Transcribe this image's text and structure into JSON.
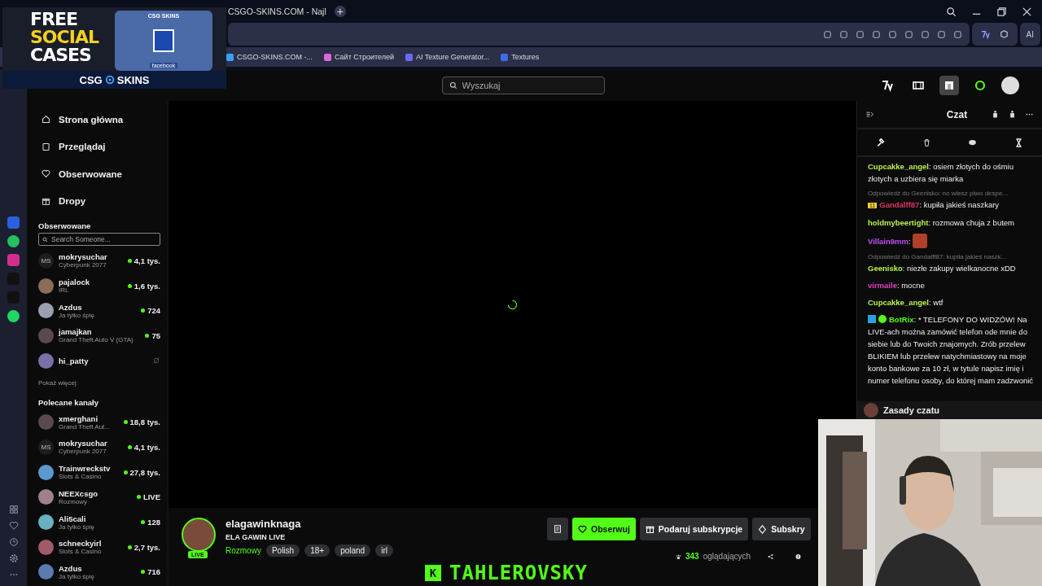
{
  "ad_overlay": {
    "headline": [
      "FREE",
      "SOCIAL",
      "CASES"
    ],
    "brand": "CSG",
    "brand2": "SKINS",
    "box_label": "CSG SKINS",
    "box_tag": "facebook"
  },
  "browser": {
    "tab_title": "CSGO-SKINS.COM - Najl",
    "new_tab": "+",
    "ai_button": "AI",
    "bookmarks": [
      {
        "label": "CSGO-SKINS.COM -...",
        "color": "#3aa0ff"
      },
      {
        "label": "Сайт Строителей",
        "color": "#d86ad8"
      },
      {
        "label": "AI Texture Generator...",
        "color": "#6a6aff"
      },
      {
        "label": "Textures",
        "color": "#3b6cf0"
      }
    ]
  },
  "header": {
    "search": {
      "placeholder": "Wyszukaj"
    }
  },
  "nav": [
    {
      "label": "Strona główna"
    },
    {
      "label": "Przeglądaj"
    },
    {
      "label": "Obserwowane"
    },
    {
      "label": "Dropy"
    }
  ],
  "followed": {
    "title": "Obserwowane",
    "search": {
      "placeholder": "Search Someone..."
    },
    "channels": [
      {
        "name": "mokrysuchar",
        "category": "Cyberpunk 2077",
        "viewers": "4,1 tys.",
        "live": true,
        "initials": "MS"
      },
      {
        "name": "pajalock",
        "category": "IRL",
        "viewers": "1,6 tys.",
        "live": true
      },
      {
        "name": "Azdus",
        "category": "Ja tylko śpię",
        "viewers": "724",
        "live": true
      },
      {
        "name": "jamajkan",
        "category": "Grand Theft Auto V (GTA)",
        "viewers": "75",
        "live": true
      },
      {
        "name": "hi_patty",
        "live": false
      }
    ],
    "show_more": "Pokaż więcej"
  },
  "recommended": {
    "title": "Polecane kanały",
    "channels": [
      {
        "name": "xmerghani",
        "category": "Grand Theft Aut...",
        "viewers": "18,8 tys.",
        "live": true
      },
      {
        "name": "mokrysuchar",
        "category": "Cyberpunk 2077",
        "viewers": "4,1 tys.",
        "live": true,
        "initials": "MS"
      },
      {
        "name": "Trainwreckstv",
        "category": "Slots & Casino",
        "viewers": "27,8 tys.",
        "live": true
      },
      {
        "name": "NEEXcsgo",
        "category": "Rozmowy",
        "viewers": "LIVE",
        "live": true
      },
      {
        "name": "Ali5cali",
        "category": "Ja tylko śpię",
        "viewers": "128",
        "live": true
      },
      {
        "name": "schneckyirl",
        "category": "Slots & Casino",
        "viewers": "2,7 tys.",
        "live": true
      },
      {
        "name": "Azdus",
        "category": "Ja tylko śpię",
        "viewers": "716",
        "live": true
      }
    ]
  },
  "chat": {
    "title": "Czat",
    "separator": ":",
    "messages": [
      {
        "user": "Cupcakke_angel",
        "color": "#b8f04a",
        "text": "osiem złotych do ośmiu złotych a uzbiera się miarka"
      },
      {
        "reply": "Odpowiedź do Geenisko: no wiesz piwo despe...",
        "badge": "11",
        "user": "Gandalff87",
        "color": "#e0365a",
        "text": "kupiła jakieś naszkary"
      },
      {
        "user": "holdmybeertight",
        "color": "#b8f04a",
        "text": "rozmowa chuja z butem"
      },
      {
        "user": "Villain9mm",
        "color": "#c050f0",
        "emote": true
      },
      {
        "reply": "Odpowiedź do Gandalff87: kupiła jakieś naszk...",
        "user": "Geenisko",
        "color": "#b8f04a",
        "text": "niezłe zakupy wielkanocne xDD"
      },
      {
        "user": "virmaile",
        "color": "#e040c0",
        "text": "mocne"
      },
      {
        "user": "Cupcakke_angel",
        "color": "#b8f04a",
        "text": "wtf"
      },
      {
        "user": "BotRix",
        "color": "#53fc18",
        "verified": true,
        "moderator": true,
        "text": "* TELEFONY DO WIDZÓW! Na LIVE-ach można zamówić telefon ode mnie do siebie lub do Twoich znajomych. Zrób przelew BLIKIEM lub przelew natychmiastowy na moje konto bankowe za 10 zł, w tytule napisz imię i numer telefonu osoby, do której mam zadzwonić"
      }
    ],
    "rules": "Zasady czatu"
  },
  "stream": {
    "channel": "elagawinknaga",
    "title": "ELA GAWIN LIVE",
    "live_badge": "LIVE",
    "category": "Rozmowy",
    "tags": [
      "Polish",
      "18+",
      "poland",
      "irl"
    ],
    "follow": "Obserwuj",
    "gift": "Podaruj subskrypcje",
    "subscribe": "Subskry",
    "viewers": "343",
    "viewers_label": "oglądających"
  },
  "overlay_logo": {
    "letter": "K",
    "name": "TAHLEROVSKY"
  }
}
